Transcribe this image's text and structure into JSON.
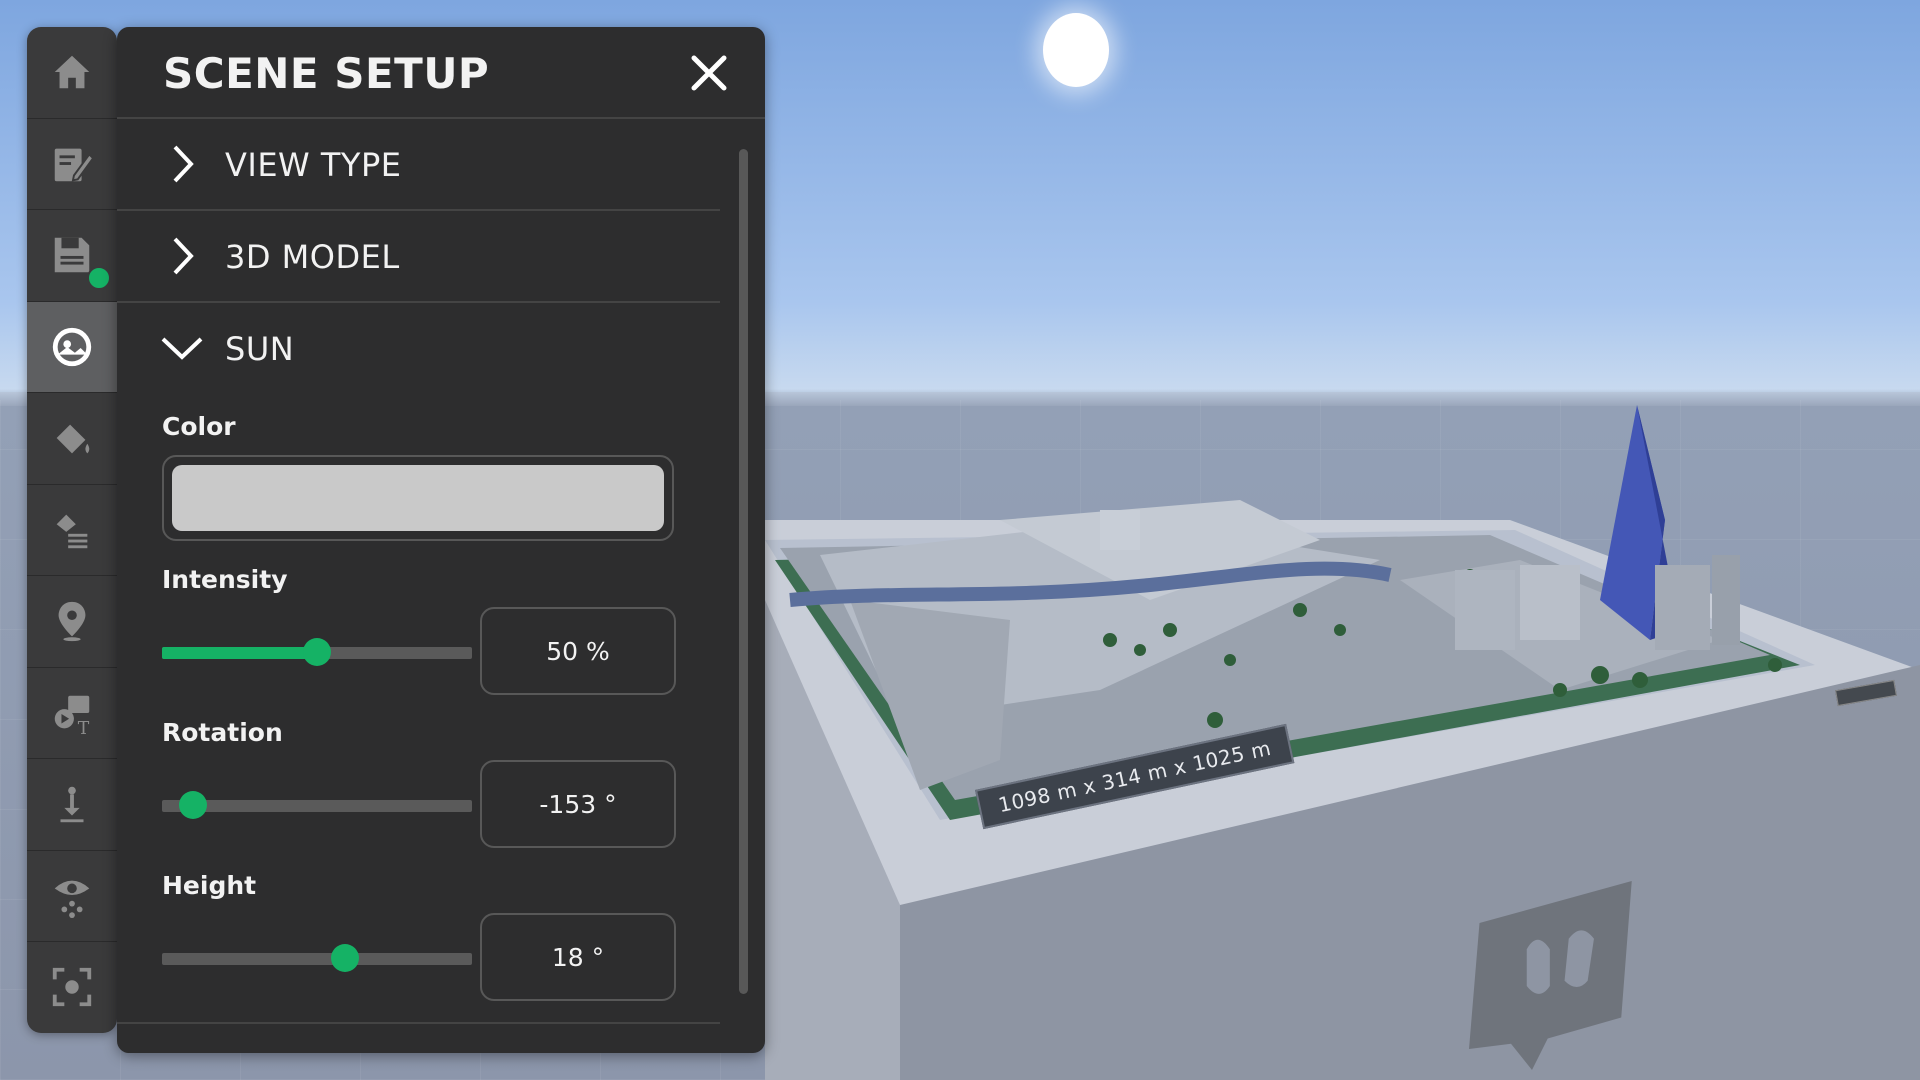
{
  "scene": {
    "scale_label": "1098 m x 314 m x 1025 m"
  },
  "toolbar": {
    "items": [
      {
        "name": "home-icon",
        "active": false
      },
      {
        "name": "edit-notes-icon",
        "active": false
      },
      {
        "name": "save-icon",
        "active": false,
        "status_dot": true
      },
      {
        "name": "scene-setup-icon",
        "active": true
      },
      {
        "name": "paint-bucket-icon",
        "active": false
      },
      {
        "name": "style-layers-icon",
        "active": false
      },
      {
        "name": "location-pin-icon",
        "active": false
      },
      {
        "name": "media-text-icon",
        "active": false
      },
      {
        "name": "measure-height-icon",
        "active": false
      },
      {
        "name": "viewpoint-eye-icon",
        "active": false
      },
      {
        "name": "focus-frame-icon",
        "active": false
      }
    ],
    "status_color": "#15b265"
  },
  "panel": {
    "title": "SCENE SETUP",
    "sections": {
      "view_type": "VIEW TYPE",
      "model": "3D MODEL",
      "sun": "SUN"
    },
    "sun": {
      "color_label": "Color",
      "color_value": "#c9c9c9",
      "intensity_label": "Intensity",
      "intensity_display": "50 %",
      "intensity_fraction": 0.5,
      "rotation_label": "Rotation",
      "rotation_display": "-153 °",
      "rotation_fraction": 0.1,
      "height_label": "Height",
      "height_display": "18 °",
      "height_fraction": 0.59
    },
    "accent_color": "#15b265"
  }
}
